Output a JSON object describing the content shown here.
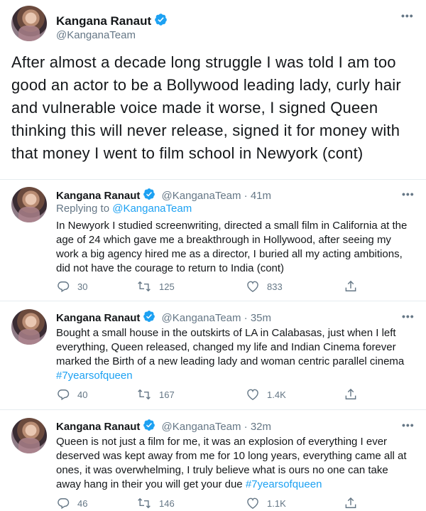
{
  "main_tweet": {
    "name": "Kangana Ranaut",
    "handle": "@KanganaTeam",
    "text": "After almost a decade long struggle I was told I am too good an actor to be a Bollywood leading lady, curly hair and vulnerable voice made it worse, I signed Queen thinking this will never release, signed it for money with that money I went to film school in Newyork (cont)"
  },
  "replies": [
    {
      "name": "Kangana Ranaut",
      "handle": "@KanganaTeam",
      "time": "41m",
      "replying_prefix": "Replying to ",
      "replying_to": "@KanganaTeam",
      "text": "In Newyork I studied screenwriting, directed a small film in California at the age of 24 which gave me a breakthrough in Hollywood, after seeing my work a big agency hired me as a director, I buried all my acting ambitions, did not have the courage to return to India (cont)",
      "hashtag": "",
      "replies": "30",
      "retweets": "125",
      "likes": "833"
    },
    {
      "name": "Kangana Ranaut",
      "handle": "@KanganaTeam",
      "time": "35m",
      "text": "Bought a small house in the outskirts of LA in Calabasas, just when I left everything, Queen released, changed my life and Indian Cinema forever marked the Birth of a new leading lady and woman centric parallel cinema ",
      "hashtag": "#7yearsofqueen",
      "replies": "40",
      "retweets": "167",
      "likes": "1.4K"
    },
    {
      "name": "Kangana Ranaut",
      "handle": "@KanganaTeam",
      "time": "32m",
      "text": "Queen is not just a film for me, it was an explosion of everything I ever deserved was kept away from me for 10 long years, everything came all at ones, it was overwhelming, I truly believe what is ours no one can take away hang in their you will get your due ",
      "hashtag": "#7yearsofqueen",
      "replies": "46",
      "retweets": "146",
      "likes": "1.1K"
    }
  ],
  "separator": " · ",
  "icons": {
    "more": "more-horizontal-icon",
    "verified": "verified-badge-icon",
    "reply": "reply-icon",
    "retweet": "retweet-icon",
    "like": "heart-icon",
    "share": "share-icon"
  },
  "colors": {
    "link": "#1da1f2",
    "secondary_text": "#657786",
    "primary_text": "#14171a",
    "divider": "#e6ecf0"
  }
}
